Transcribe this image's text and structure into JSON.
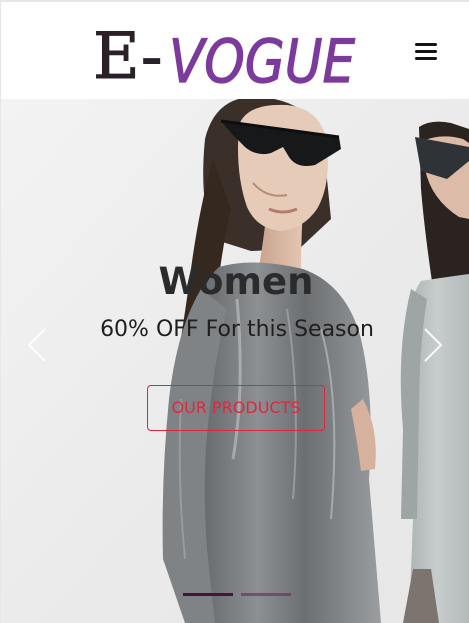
{
  "header": {
    "logo_text_e": "E-",
    "logo_text_vogue": "VOGUE",
    "menu_icon": "hamburger-menu-icon"
  },
  "hero": {
    "heading": "Women",
    "subheading": "60% OFF For this Season",
    "cta_label": "OUR PRODUCTS",
    "prev_icon": "chevron-left-icon",
    "next_icon": "chevron-right-icon",
    "slide_count": 2,
    "active_slide": 1
  },
  "colors": {
    "accent": "#e0263f",
    "logo_e": "#2a2128",
    "logo_vogue": "#7c3a9c",
    "indicator_active": "#4a1238"
  }
}
